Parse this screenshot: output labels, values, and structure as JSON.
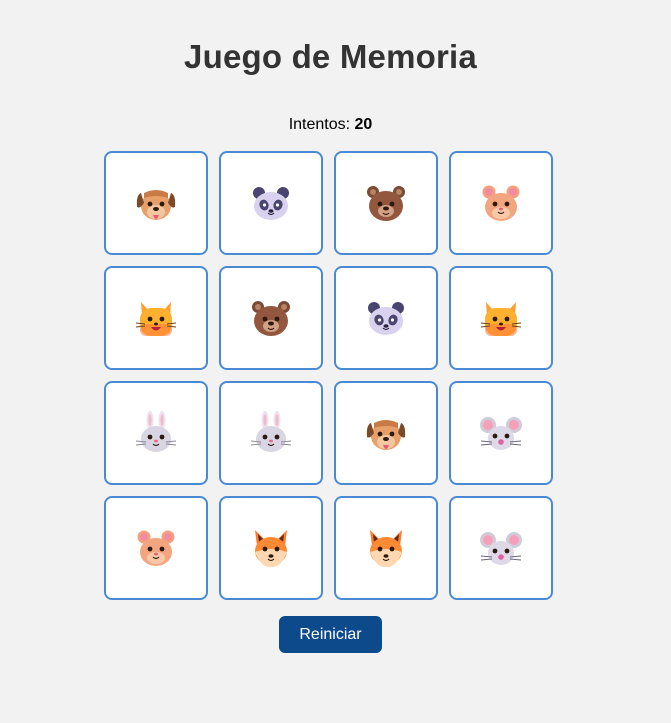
{
  "game": {
    "title": "Juego de Memoria",
    "attempts_label": "Intentos: ",
    "attempts_value": "20",
    "reset_label": "Reiniciar"
  },
  "cards": [
    {
      "animal": "dog"
    },
    {
      "animal": "panda"
    },
    {
      "animal": "bear"
    },
    {
      "animal": "hamster"
    },
    {
      "animal": "cat"
    },
    {
      "animal": "bear"
    },
    {
      "animal": "panda"
    },
    {
      "animal": "cat"
    },
    {
      "animal": "rabbit"
    },
    {
      "animal": "rabbit"
    },
    {
      "animal": "dog"
    },
    {
      "animal": "mouse"
    },
    {
      "animal": "hamster"
    },
    {
      "animal": "fox"
    },
    {
      "animal": "fox"
    },
    {
      "animal": "mouse"
    }
  ],
  "colors": {
    "background": "#f2f2f2",
    "card_border": "#4a8ad4",
    "button": "#0d4a8c"
  }
}
